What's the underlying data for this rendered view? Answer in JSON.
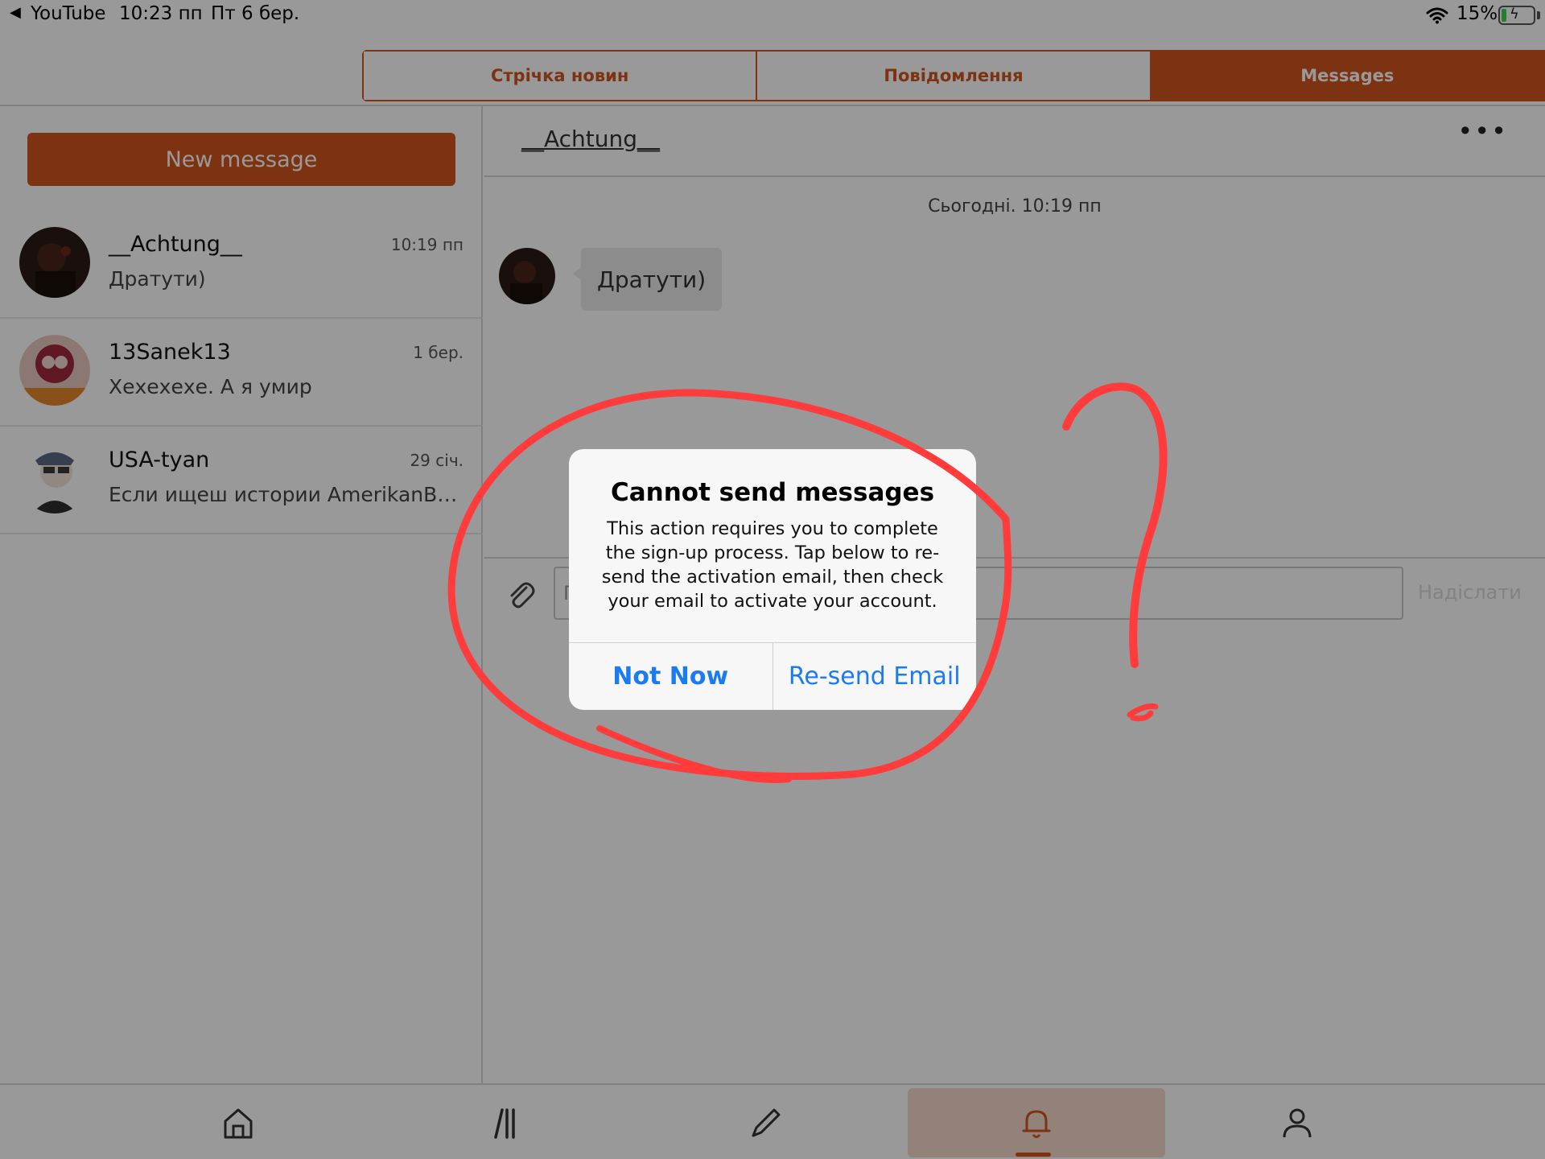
{
  "status_bar": {
    "back_arrow": "◀",
    "back_app": "YouTube",
    "time": "10:23 пп",
    "date": "Пт 6 бер.",
    "battery_percent": "15%",
    "battery_level": 0.15,
    "charging": true
  },
  "top_tabs": [
    "Стрічка новин",
    "Повідомлення",
    "Messages"
  ],
  "active_tab": "Messages",
  "accent_color": "#d0541d",
  "sidebar": {
    "new_message_label": "New message",
    "conversations": [
      {
        "name": "__Achtung__",
        "preview": "Дратути)",
        "time": "10:19 пп"
      },
      {
        "name": "13Sanek13",
        "preview": "Хехехехе. А я умир",
        "time": "1 бер."
      },
      {
        "name": "USA-tyan",
        "preview": "Если ищеш истории AmerikanBoy т...",
        "time": "29 січ."
      }
    ]
  },
  "chat": {
    "title": "__Achtung__",
    "menu_glyph": "•••",
    "date_divider": "Сьогодні. 10:19 пп",
    "messages": [
      {
        "text": "Дратути)"
      }
    ],
    "input_placeholder": "П",
    "send_label": "Надіслати"
  },
  "alert": {
    "title": "Cannot send messages",
    "body": "This action requires you to complete the sign-up process. Tap below to re-send the activation email, then check your email to activate your account.",
    "buttons": [
      "Not Now",
      "Re-send Email"
    ],
    "button_color": "#1a7cf0"
  },
  "bottom_nav": {
    "items": [
      "home-icon",
      "feed-icon",
      "compose-icon",
      "notifications-icon",
      "profile-icon"
    ],
    "active": "notifications-icon"
  },
  "annotation_color": "#ff3b3b"
}
